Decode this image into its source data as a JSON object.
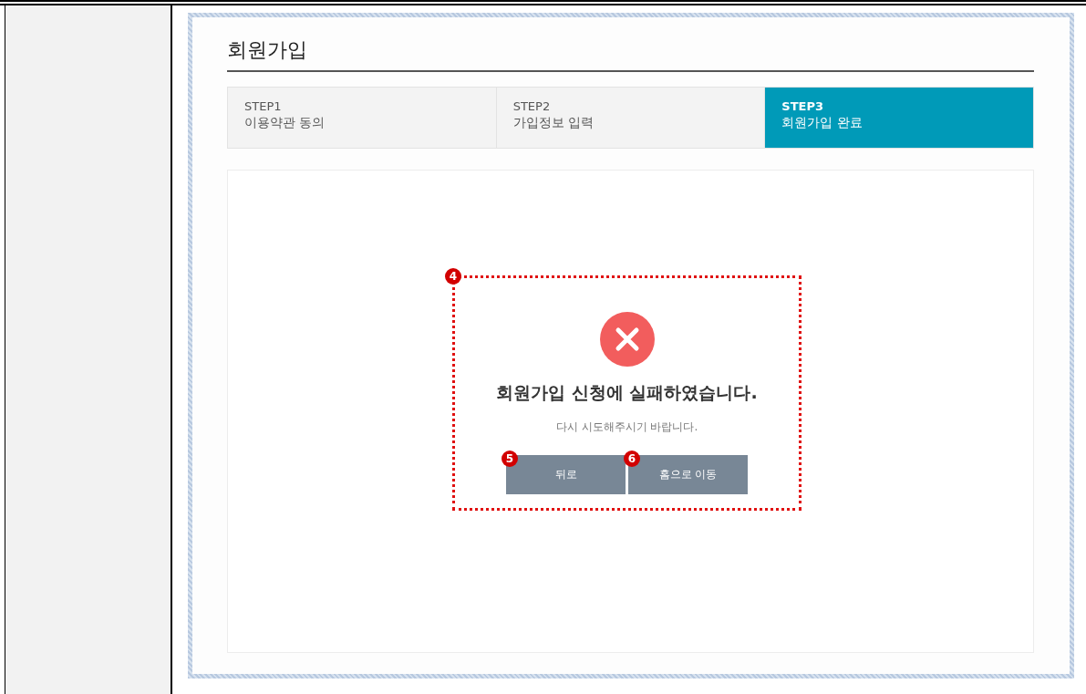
{
  "page_title": "회원가입",
  "steps": [
    {
      "label": "STEP1",
      "description": "이용약관 동의",
      "selected": false
    },
    {
      "label": "STEP2",
      "description": "가입정보 입력",
      "selected": false
    },
    {
      "label": "STEP3",
      "description": "회원가입 완료",
      "selected": true
    }
  ],
  "dialog": {
    "annotation": "4",
    "kind": "error",
    "message": "회원가입 신청에 실패하였습니다.",
    "hint": "다시 시도해주시기 바랍니다.",
    "buttons": [
      {
        "label": "뒤로",
        "annotation": "5"
      },
      {
        "label": "홈으로 이동",
        "annotation": "6"
      }
    ]
  }
}
